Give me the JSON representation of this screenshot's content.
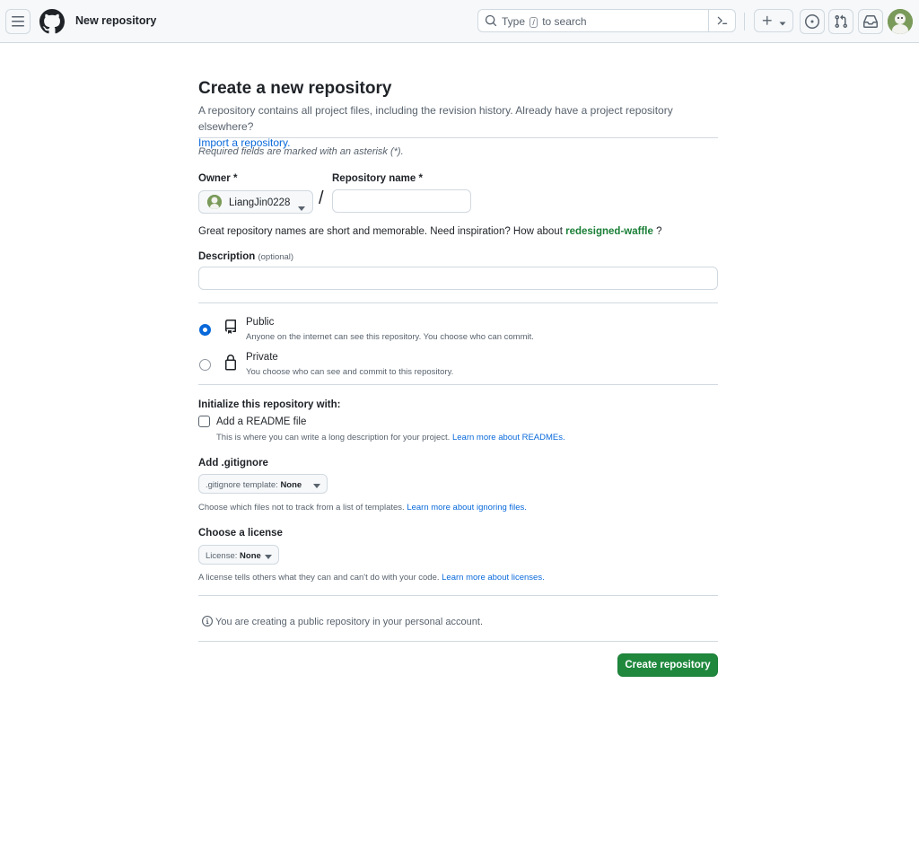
{
  "header": {
    "title": "New repository",
    "search_placeholder_before": "Type",
    "search_key": "/",
    "search_placeholder_after": "to search",
    "icons": [
      "menu-icon",
      "github-logo-icon",
      "search-icon",
      "command-palette-icon",
      "plus-icon",
      "chevron-down-icon",
      "issues-icon",
      "pull-requests-icon",
      "inbox-icon"
    ]
  },
  "page": {
    "title": "Create a new repository",
    "subtitle": "A repository contains all project files, including the revision history. Already have a project repository elsewhere?",
    "import_link": "Import a repository.",
    "required_note": "Required fields are marked with an asterisk (*)."
  },
  "owner": {
    "label": "Owner *",
    "value": "LiangJin0228"
  },
  "repo_name": {
    "label": "Repository name *",
    "value": ""
  },
  "name_hint": {
    "text": "Great repository names are short and memorable. Need inspiration? How about",
    "suggestion": "redesigned-waffle",
    "suffix": "?"
  },
  "description": {
    "label": "Description",
    "optional": "(optional)",
    "value": ""
  },
  "visibility": {
    "selected": "public",
    "public": {
      "title": "Public",
      "desc": "Anyone on the internet can see this repository. You choose who can commit."
    },
    "private": {
      "title": "Private",
      "desc": "You choose who can see and commit to this repository."
    }
  },
  "init": {
    "heading": "Initialize this repository with:",
    "readme_label": "Add a README file",
    "readme_checked": false,
    "readme_desc": "This is where you can write a long description for your project.",
    "readme_link": "Learn more about READMEs."
  },
  "gitignore": {
    "heading": "Add .gitignore",
    "dropdown_prefix": ".gitignore template:",
    "dropdown_value": "None",
    "desc": "Choose which files not to track from a list of templates.",
    "link": "Learn more about ignoring files."
  },
  "license": {
    "heading": "Choose a license",
    "dropdown_prefix": "License:",
    "dropdown_value": "None",
    "desc": "A license tells others what they can and can't do with your code.",
    "link": "Learn more about licenses."
  },
  "notice": "You are creating a public repository in your personal account.",
  "submit_label": "Create repository",
  "colors": {
    "primary_button": "#1f883d",
    "link": "#0969da",
    "suggestion": "#1a7f37",
    "radio_selected": "#0969da"
  }
}
